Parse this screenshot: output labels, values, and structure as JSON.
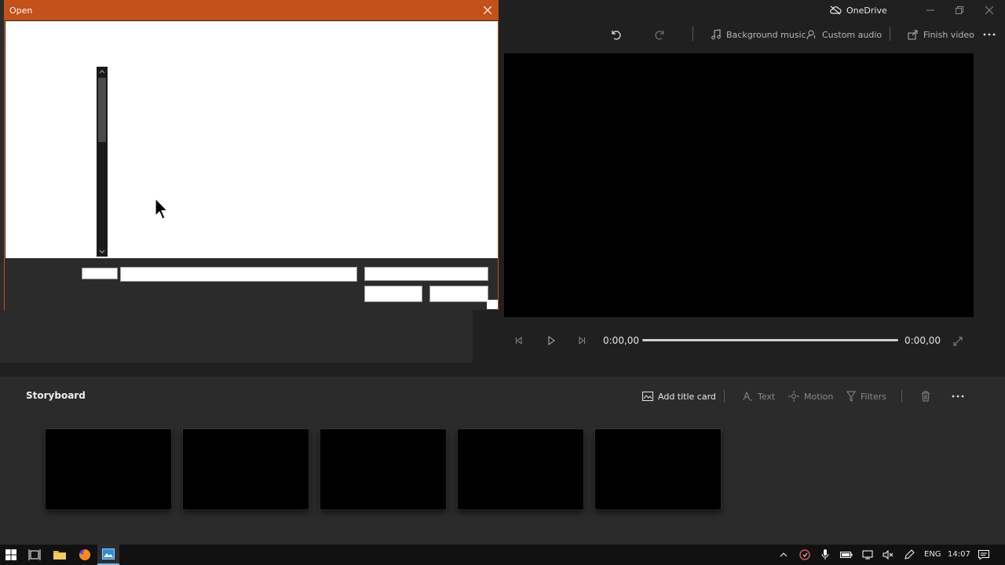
{
  "dialog": {
    "title": "Open",
    "filename_value": "",
    "filter_value": "",
    "open_label": "",
    "cancel_label": ""
  },
  "app": {
    "onedrive_label": "OneDrive",
    "toolbar": {
      "background_music": "Background music",
      "custom_audio": "Custom audio",
      "finish_video": "Finish video"
    },
    "player": {
      "current_time": "0:00,00",
      "total_time": "0:00,00",
      "progress": 0
    },
    "storyboard": {
      "title": "Storyboard",
      "add_title_card": "Add title card",
      "text": "Text",
      "motion": "Motion",
      "filters": "Filters",
      "clip_count": 5
    }
  },
  "taskbar": {
    "language": "ENG",
    "time": "14:07"
  },
  "colors": {
    "accent": "#c4501a",
    "taskbar_active": "#76b9ed"
  }
}
